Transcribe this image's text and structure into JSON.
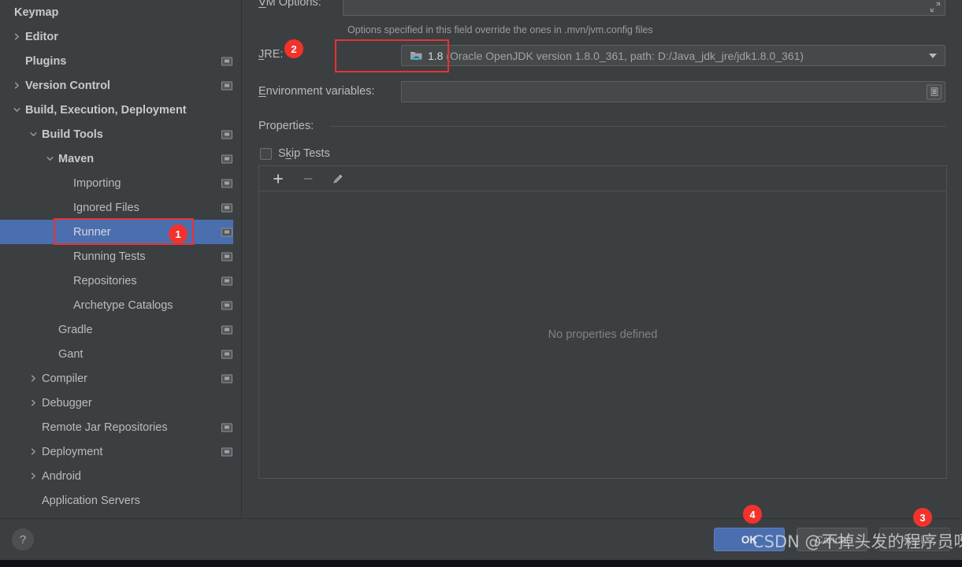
{
  "sidebar": {
    "items": [
      {
        "label": "Keymap",
        "indent": 18,
        "bold": true,
        "arrow": "none",
        "badge": false,
        "selected": false
      },
      {
        "label": "Editor",
        "indent": 32,
        "bold": true,
        "arrow": "right",
        "badge": false,
        "selected": false
      },
      {
        "label": "Plugins",
        "indent": 32,
        "bold": true,
        "arrow": "none",
        "badge": true,
        "selected": false
      },
      {
        "label": "Version Control",
        "indent": 32,
        "bold": true,
        "arrow": "right",
        "badge": true,
        "selected": false
      },
      {
        "label": "Build, Execution, Deployment",
        "indent": 32,
        "bold": true,
        "arrow": "down",
        "badge": false,
        "selected": false
      },
      {
        "label": "Build Tools",
        "indent": 53,
        "bold": true,
        "arrow": "down",
        "badge": true,
        "selected": false
      },
      {
        "label": "Maven",
        "indent": 74,
        "bold": true,
        "arrow": "down",
        "badge": true,
        "selected": false
      },
      {
        "label": "Importing",
        "indent": 93,
        "bold": false,
        "arrow": "none",
        "badge": true,
        "selected": false
      },
      {
        "label": "Ignored Files",
        "indent": 93,
        "bold": false,
        "arrow": "none",
        "badge": true,
        "selected": false
      },
      {
        "label": "Runner",
        "indent": 93,
        "bold": false,
        "arrow": "none",
        "badge": true,
        "selected": true
      },
      {
        "label": "Running Tests",
        "indent": 93,
        "bold": false,
        "arrow": "none",
        "badge": true,
        "selected": false
      },
      {
        "label": "Repositories",
        "indent": 93,
        "bold": false,
        "arrow": "none",
        "badge": true,
        "selected": false
      },
      {
        "label": "Archetype Catalogs",
        "indent": 93,
        "bold": false,
        "arrow": "none",
        "badge": true,
        "selected": false
      },
      {
        "label": "Gradle",
        "indent": 74,
        "bold": false,
        "arrow": "none",
        "badge": true,
        "selected": false
      },
      {
        "label": "Gant",
        "indent": 74,
        "bold": false,
        "arrow": "none",
        "badge": true,
        "selected": false
      },
      {
        "label": "Compiler",
        "indent": 53,
        "bold": false,
        "arrow": "right",
        "badge": true,
        "selected": false
      },
      {
        "label": "Debugger",
        "indent": 53,
        "bold": false,
        "arrow": "right",
        "badge": false,
        "selected": false
      },
      {
        "label": "Remote Jar Repositories",
        "indent": 53,
        "bold": false,
        "arrow": "none",
        "badge": true,
        "selected": false
      },
      {
        "label": "Deployment",
        "indent": 53,
        "bold": false,
        "arrow": "right",
        "badge": true,
        "selected": false
      },
      {
        "label": "Android",
        "indent": 53,
        "bold": false,
        "arrow": "right",
        "badge": false,
        "selected": false
      },
      {
        "label": "Application Servers",
        "indent": 53,
        "bold": false,
        "arrow": "none",
        "badge": false,
        "selected": false
      }
    ]
  },
  "main": {
    "vm_options": {
      "label": "VM Options:",
      "mnemonic": "V",
      "rest": "M Options:",
      "value": "",
      "hint": "Options specified in this field override the ones in .mvn/jvm.config files"
    },
    "jre": {
      "label": "JRE:",
      "mnemonic": "J",
      "rest": "RE:",
      "version": "1.8",
      "description": "(Oracle OpenJDK version 1.8.0_361, path: D:/Java_jdk_jre/jdk1.8.0_361)"
    },
    "environment_variables": {
      "label": "Environment variables:",
      "mnemonic": "E",
      "rest": "nvironment variables:",
      "value": ""
    },
    "properties": {
      "section_label": "Properties:",
      "skip_tests_label": "Skip Tests",
      "skip_tests_mnemonic_pre": "S",
      "skip_tests_mnemonic": "k",
      "skip_tests_post": "ip Tests",
      "skip_tests_checked": false,
      "toolbar": {
        "add_label": "+",
        "remove_label": "–",
        "edit_label": "edit"
      },
      "empty_text": "No properties defined"
    }
  },
  "footer": {
    "help_label": "?",
    "ok_label": "OK",
    "cancel_label": "Cancel",
    "apply_label": "Apply"
  },
  "annotations": {
    "badge_1": "1",
    "badge_2": "2",
    "badge_3": "3",
    "badge_4": "4",
    "accent_color": "#f3322c"
  },
  "watermark": {
    "text": "CSDN @不掉头发的程序员呀"
  }
}
